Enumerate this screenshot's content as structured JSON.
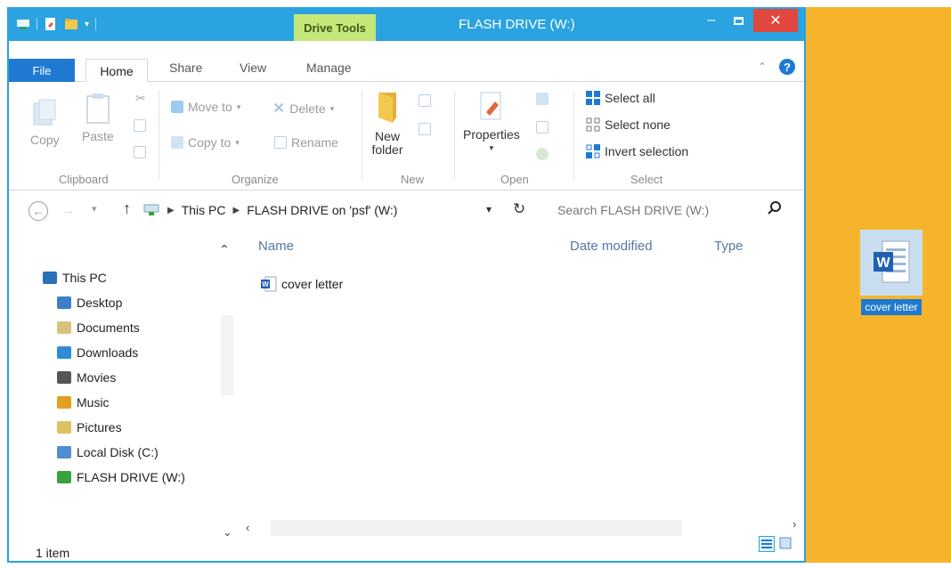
{
  "window": {
    "title": "FLASH DRIVE (W:)",
    "context_tab": "Drive Tools",
    "help_glyph": "?",
    "minimize_glyph": "–",
    "close_glyph": "✕"
  },
  "ribbon_tabs": [
    "File",
    "Home",
    "Share",
    "View",
    "Manage"
  ],
  "ribbon": {
    "clipboard": {
      "label": "Clipboard",
      "copy": "Copy",
      "paste": "Paste"
    },
    "organize": {
      "label": "Organize",
      "move_to": "Move to",
      "copy_to": "Copy to",
      "delete": "Delete",
      "rename": "Rename"
    },
    "new": {
      "label": "New",
      "new_folder": "New folder"
    },
    "open": {
      "label": "Open",
      "properties": "Properties"
    },
    "select": {
      "label": "Select",
      "select_all": "Select all",
      "select_none": "Select none",
      "invert_selection": "Invert selection"
    }
  },
  "address": {
    "crumbs": [
      "This PC",
      "FLASH DRIVE on 'psf' (W:)"
    ],
    "search_placeholder": "Search FLASH DRIVE (W:)"
  },
  "nav_pane": {
    "items": [
      {
        "label": "This PC",
        "icon": "computer-icon",
        "color": "#2b6fb6"
      },
      {
        "label": "Desktop",
        "icon": "desktop-icon",
        "color": "#3a7fc8"
      },
      {
        "label": "Documents",
        "icon": "documents-icon",
        "color": "#d9c27a"
      },
      {
        "label": "Downloads",
        "icon": "downloads-icon",
        "color": "#2f8ad8"
      },
      {
        "label": "Movies",
        "icon": "movies-icon",
        "color": "#555555"
      },
      {
        "label": "Music",
        "icon": "music-icon",
        "color": "#e0a020"
      },
      {
        "label": "Pictures",
        "icon": "pictures-icon",
        "color": "#e0c060"
      },
      {
        "label": "Local Disk (C:)",
        "icon": "local-disk-icon",
        "color": "#4d8ed0"
      },
      {
        "label": "FLASH DRIVE (W:)",
        "icon": "flash-drive-icon",
        "color": "#3aa040"
      }
    ]
  },
  "content": {
    "columns": [
      "Name",
      "Date modified",
      "Type"
    ],
    "files": [
      {
        "name": "cover letter",
        "icon": "word-document-icon"
      }
    ]
  },
  "status": {
    "item_count": "1 item"
  },
  "desktop": {
    "icon_label": "cover letter",
    "icon": "word-document-icon"
  },
  "colors": {
    "accent": "#2aa3e0",
    "file_tab": "#1f79d1",
    "drive_tools": "#c4e77a",
    "close": "#e0483f",
    "desktop_bg": "#f6b42c"
  }
}
